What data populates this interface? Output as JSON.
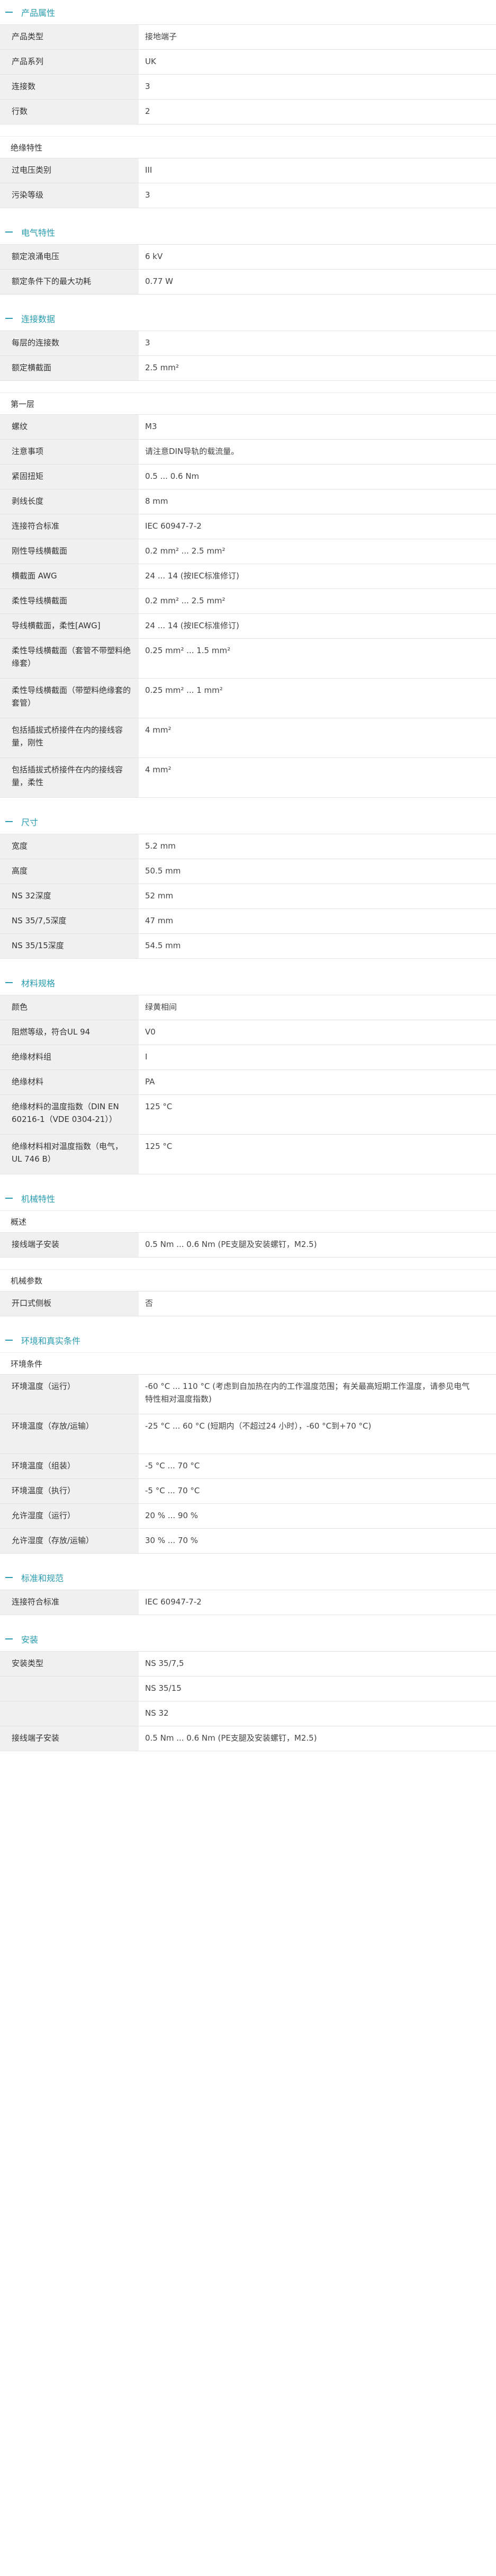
{
  "sections": [
    {
      "title": "产品属性",
      "blocks": [
        {
          "rows": [
            [
              "产品类型",
              "接地端子"
            ],
            [
              "产品系列",
              "UK"
            ],
            [
              "连接数",
              "3"
            ],
            [
              "行数",
              "2"
            ]
          ]
        },
        {
          "subtitle": "绝缘特性",
          "rows": [
            [
              "过电压类别",
              "III"
            ],
            [
              "污染等级",
              "3"
            ]
          ]
        }
      ]
    },
    {
      "title": "电气特性",
      "blocks": [
        {
          "rows": [
            [
              "额定浪涌电压",
              "6 kV"
            ],
            [
              "额定条件下的最大功耗",
              "0.77 W"
            ]
          ]
        }
      ]
    },
    {
      "title": "连接数据",
      "blocks": [
        {
          "rows": [
            [
              "每层的连接数",
              "3"
            ],
            [
              "额定横截面",
              "2.5 mm²"
            ]
          ]
        },
        {
          "subtitle": "第一层",
          "rows": [
            [
              "螺纹",
              "M3"
            ],
            [
              "注意事项",
              "请注意DIN导轨的载流量。"
            ],
            [
              "紧固扭矩",
              "0.5 ... 0.6 Nm"
            ],
            [
              "剥线长度",
              "8 mm"
            ],
            [
              "连接符合标准",
              "IEC 60947-7-2"
            ],
            [
              "刚性导线横截面",
              "0.2 mm² ... 2.5 mm²"
            ],
            [
              "横截面 AWG",
              "24 ... 14 (按IEC标准修订)"
            ],
            [
              "柔性导线横截面",
              "0.2 mm² ... 2.5 mm²"
            ],
            [
              "导线横截面，柔性[AWG]",
              "24 ... 14 (按IEC标准修订)"
            ],
            [
              "柔性导线横截面（套管不带塑料绝缘套）",
              "0.25 mm² ... 1.5 mm²"
            ],
            [
              "柔性导线横截面（带塑料绝缘套的套管）",
              "0.25 mm² ... 1 mm²"
            ],
            [
              "包括插拔式桥接件在内的接线容量，刚性",
              "4 mm²"
            ],
            [
              "包括插拔式桥接件在内的接线容量，柔性",
              "4 mm²"
            ]
          ]
        }
      ]
    },
    {
      "title": "尺寸",
      "blocks": [
        {
          "rows": [
            [
              "宽度",
              "5.2 mm"
            ],
            [
              "高度",
              "50.5 mm"
            ],
            [
              "NS 32深度",
              "52 mm"
            ],
            [
              "NS 35/7,5深度",
              "47 mm"
            ],
            [
              "NS 35/15深度",
              "54.5 mm"
            ]
          ]
        }
      ]
    },
    {
      "title": "材料规格",
      "blocks": [
        {
          "rows": [
            [
              "颜色",
              "绿黄相间"
            ],
            [
              "阻燃等级，符合UL 94",
              "V0"
            ],
            [
              "绝缘材料组",
              "I"
            ],
            [
              "绝缘材料",
              "PA"
            ],
            [
              "绝缘材料的温度指数（DIN EN 60216-1（VDE 0304-21））",
              "125 °C"
            ],
            [
              "绝缘材料相对温度指数（电气，UL 746 B）",
              "125 °C"
            ]
          ]
        }
      ]
    },
    {
      "title": "机械特性",
      "blocks": [
        {
          "subtitle": "概述",
          "rows": [
            [
              "接线端子安装",
              "0.5 Nm ... 0.6 Nm (PE支腿及安装螺钉，M2.5)"
            ]
          ]
        },
        {
          "subtitle": "机械参数",
          "rows": [
            [
              "开口式侧板",
              "否"
            ]
          ]
        }
      ]
    },
    {
      "title": "环境和真实条件",
      "blocks": [
        {
          "subtitle": "环境条件",
          "rows": [
            [
              "环境温度（运行）",
              "-60 °C ... 110 °C (考虑到自加热在内的工作温度范围；有关最高短期工作温度，请参见电气特性相对温度指数)"
            ],
            [
              "环境温度（存放/运输）",
              "-25 °C ... 60 °C (短期内（不超过24 小时），-60 °C到+70 °C)"
            ],
            [
              "环境温度（组装）",
              "-5 °C ... 70 °C"
            ],
            [
              "环境温度（执行）",
              "-5 °C ... 70 °C"
            ],
            [
              "允许湿度（运行）",
              "20 % ... 90 %"
            ],
            [
              "允许湿度（存放/运输）",
              "30 % ... 70 %"
            ]
          ]
        }
      ]
    },
    {
      "title": "标准和规范",
      "blocks": [
        {
          "rows": [
            [
              "连接符合标准",
              "IEC 60947-7-2"
            ]
          ]
        }
      ]
    },
    {
      "title": "安装",
      "blocks": [
        {
          "rows": [
            [
              "安装类型",
              "NS 35/7,5"
            ],
            [
              "",
              "NS 35/15"
            ],
            [
              "",
              "NS 32"
            ],
            [
              "接线端子安装",
              "0.5 Nm ... 0.6 Nm (PE支腿及安装螺钉，M2.5)"
            ]
          ]
        }
      ]
    }
  ]
}
